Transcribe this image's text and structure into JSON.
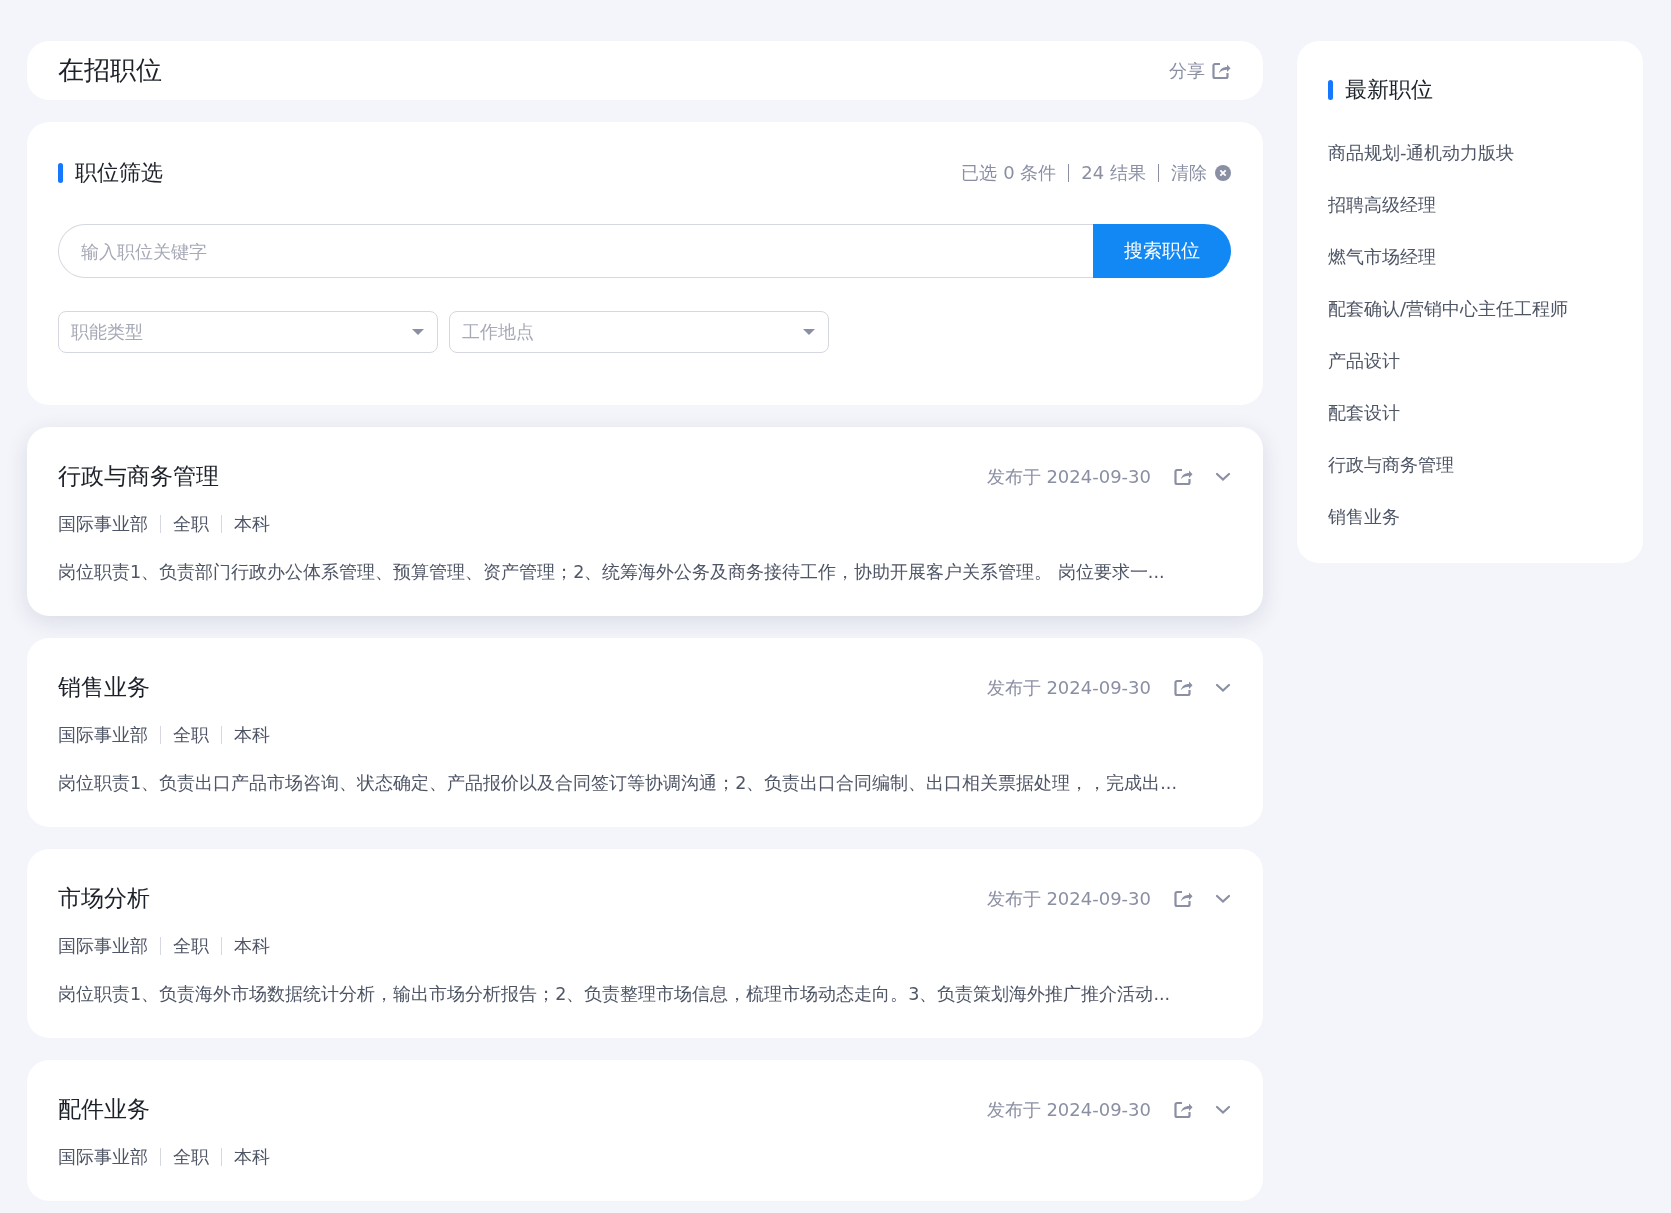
{
  "header": {
    "title": "在招职位",
    "share": "分享"
  },
  "filter": {
    "title": "职位筛选",
    "selected_count": "已选 0 条件",
    "result_count": "24 结果",
    "clear": "清除",
    "search": {
      "placeholder": "输入职位关键字",
      "button": "搜索职位"
    },
    "dropdowns": [
      {
        "placeholder": "职能类型"
      },
      {
        "placeholder": "工作地点"
      }
    ]
  },
  "jobs": [
    {
      "title": "行政与商务管理",
      "date": "发布于 2024-09-30",
      "tags": [
        "国际事业部",
        "全职",
        "本科"
      ],
      "description": "岗位职责1、负责部门行政办公体系管理、预算管理、资产管理；2、统筹海外公务及商务接待工作，协助开展客户关系管理。 岗位要求一...",
      "highlighted": true
    },
    {
      "title": "销售业务",
      "date": "发布于 2024-09-30",
      "tags": [
        "国际事业部",
        "全职",
        "本科"
      ],
      "description": "岗位职责1、负责出口产品市场咨询、状态确定、产品报价以及合同签订等协调沟通；2、负责出口合同编制、出口相关票据处理，，完成出...",
      "highlighted": false
    },
    {
      "title": "市场分析",
      "date": "发布于 2024-09-30",
      "tags": [
        "国际事业部",
        "全职",
        "本科"
      ],
      "description": "岗位职责1、负责海外市场数据统计分析，输出市场分析报告；2、负责整理市场信息，梳理市场动态走向。3、负责策划海外推广推介活动...",
      "highlighted": false
    },
    {
      "title": "配件业务",
      "date": "发布于 2024-09-30",
      "tags": [
        "国际事业部",
        "全职",
        "本科"
      ],
      "highlighted": false
    }
  ],
  "latest": {
    "title": "最新职位",
    "items": [
      "商品规划-通机动力版块",
      "招聘高级经理",
      "燃气市场经理",
      "配套确认/营销中心主任工程师",
      "产品设计",
      "配套设计",
      "行政与商务管理",
      "销售业务"
    ]
  }
}
